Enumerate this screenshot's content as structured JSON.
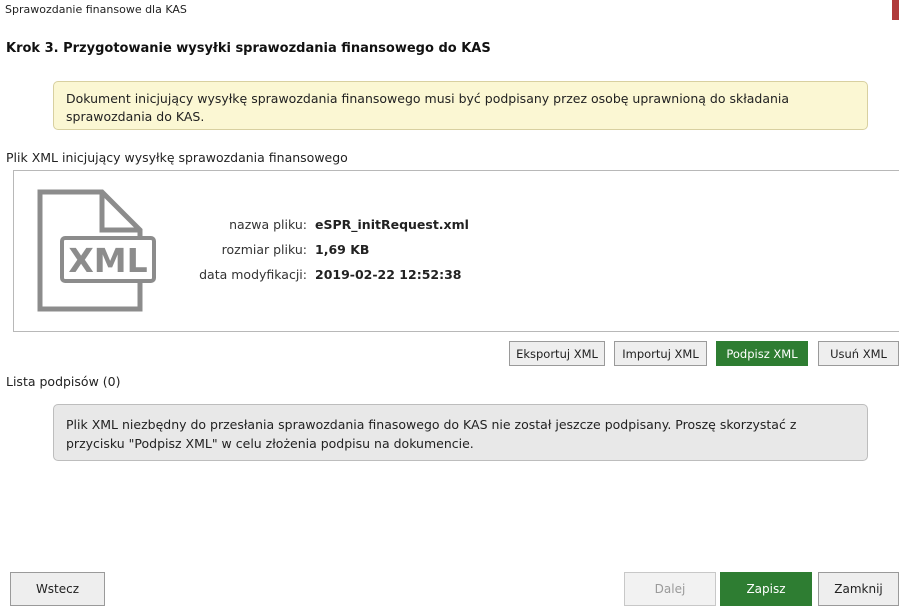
{
  "window": {
    "title": "Sprawozdanie finansowe dla KAS"
  },
  "step": {
    "heading": "Krok 3. Przygotowanie wysyłki sprawozdania finansowego do KAS"
  },
  "info": {
    "text": "Dokument inicjujący wysyłkę sprawozdania finansowego musi być podpisany przez osobę uprawnioną do składania sprawozdania do KAS."
  },
  "xml_section": {
    "label": "Plik XML inicjujący wysyłkę sprawozdania finansowego",
    "icon_text": "XML",
    "icon": "xml-file-icon",
    "fields": [
      {
        "label": "nazwa pliku:",
        "value": "eSPR_initRequest.xml"
      },
      {
        "label": "rozmiar pliku:",
        "value": "1,69 KB"
      },
      {
        "label": "data modyfikacji:",
        "value": "2019-02-22 12:52:38"
      }
    ]
  },
  "actions": {
    "export": "Eksportuj XML",
    "import": "Importuj XML",
    "sign": "Podpisz XML",
    "remove": "Usuń XML"
  },
  "signatures": {
    "label": "Lista podpisów (0)",
    "note": "Plik XML niezbędny do przesłania sprawozdania finasowego do KAS nie został jeszcze podpisany. Proszę skorzystać z przycisku \"Podpisz XML\" w celu złożenia podpisu na dokumencie."
  },
  "footer": {
    "back": "Wstecz",
    "next": "Dalej",
    "save": "Zapisz",
    "close": "Zamknij"
  },
  "colors": {
    "accent_green": "#2e7d32",
    "info_bg": "#fbf7d3",
    "note_bg": "#e8e8e8",
    "close_red": "#b03a3a"
  }
}
